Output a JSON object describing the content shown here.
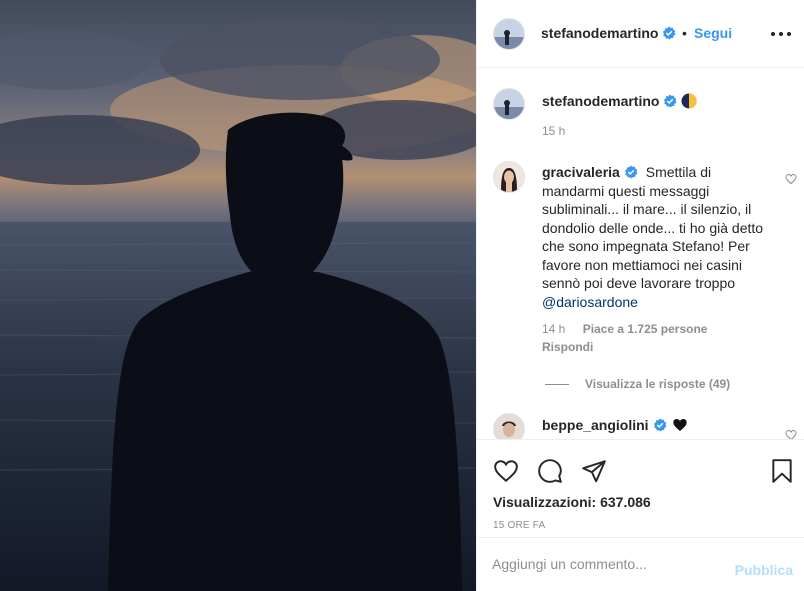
{
  "post_author": {
    "username": "stefanodemartino",
    "verified": true,
    "follow_separator": "•",
    "follow_label": "Segui",
    "avatar_icon": "profile-photo"
  },
  "caption": {
    "username": "stefanodemartino",
    "emoji": "first-quarter-moon",
    "time": "15 h"
  },
  "comments": [
    {
      "username": "gracivaleria",
      "verified": true,
      "text": "Smettila di mandarmi questi messaggi subliminali... il mare... il silenzio, il dondolio delle onde... ti ho già detto che sono impegnata Stefano! Per favore non mettiamoci nei casini sennò poi deve lavorare troppo",
      "mention": "@dariosardone",
      "time": "14 h",
      "likes": "Piace a 1.725 persone",
      "reply_label": "Rispondi",
      "view_replies": "Visualizza le risposte (49)"
    },
    {
      "username": "beppe_angiolini",
      "verified": true,
      "emoji": "black-heart"
    }
  ],
  "actions": {
    "icons": [
      "heart-icon",
      "comment-icon",
      "share-icon",
      "bookmark-icon"
    ]
  },
  "stats": {
    "views": "Visualizzazioni: 637.086",
    "posted": "15 ORE FA"
  },
  "composer": {
    "placeholder": "Aggiungi un commento...",
    "publish_label": "Pubblica"
  },
  "colors": {
    "link": "#3897f0",
    "mention": "#00376b",
    "muted": "#8e8e8e",
    "publish_disabled": "#b2dffc",
    "verified": "#3897f0"
  }
}
